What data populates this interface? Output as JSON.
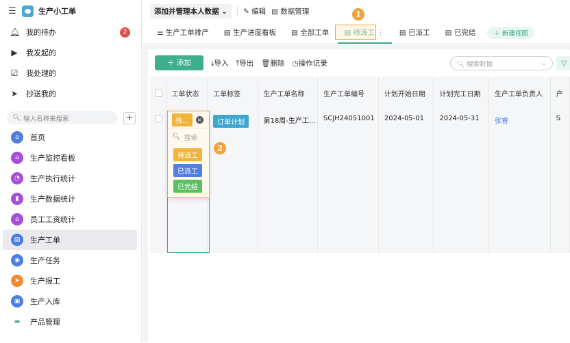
{
  "app": {
    "title": "生产小工单"
  },
  "sidebar": {
    "top_items": [
      {
        "label": "我的待办",
        "icon": "bell-icon",
        "badge": "2"
      },
      {
        "label": "我发起的",
        "icon": "play-icon"
      },
      {
        "label": "我处理的",
        "icon": "inbox-check-icon"
      },
      {
        "label": "抄送我的",
        "icon": "send-icon"
      }
    ],
    "search_placeholder": "输入名称来搜索",
    "items": [
      {
        "label": "首页",
        "icon": "home-icon",
        "color": "#4a7ee0"
      },
      {
        "label": "生产监控看板",
        "icon": "home-icon",
        "color": "#a64fd8"
      },
      {
        "label": "生产执行统计",
        "icon": "pie-icon",
        "color": "#a64fd8"
      },
      {
        "label": "生产数据统计",
        "icon": "bar-chart-icon",
        "color": "#a64fd8"
      },
      {
        "label": "员工工资统计",
        "icon": "house-icon",
        "color": "#a64fd8"
      },
      {
        "label": "生产工单",
        "icon": "document-icon",
        "color": "#4a7ee0",
        "active": true
      },
      {
        "label": "生产任务",
        "icon": "target-icon",
        "color": "#4a7ee0"
      },
      {
        "label": "生产报工",
        "icon": "send-icon",
        "color": "#ef8a2e"
      },
      {
        "label": "生产入库",
        "icon": "clipboard-icon",
        "color": "#4a7ee0"
      },
      {
        "label": "产品管理",
        "icon": "folder-icon",
        "color": "#3fae8c"
      }
    ]
  },
  "topbar": {
    "dropdown": "添加并管理本人数据",
    "edit": "编辑",
    "data_manage": "数据管理"
  },
  "tabs": [
    "生产工单排产",
    "生产进度看板",
    "全部工单",
    "待派工",
    "已派工",
    "已完结"
  ],
  "active_tab": "待派工",
  "new_view": "新建视图",
  "toolbar": {
    "add": "添加",
    "import": "导入",
    "export": "导出",
    "delete": "删除",
    "log": "操作记录",
    "search_placeholder": "搜索数据"
  },
  "table": {
    "headers": [
      "工单状态",
      "工单标签",
      "生产工单名称",
      "生产工单编号",
      "计划开始日期",
      "计划完工日期",
      "生产工单负责人",
      "产"
    ],
    "row": {
      "status": "待...",
      "tag": "订单计划",
      "name": "第18周-生产工...",
      "code": "SCJH24051001",
      "start": "2024-05-01",
      "end": "2024-05-31",
      "owner": "张睿",
      "next": "S"
    }
  },
  "status_popup": {
    "search_placeholder": "搜索",
    "options": [
      {
        "label": "待派工",
        "color": "#f0b43c"
      },
      {
        "label": "已派工",
        "color": "#4f7fe0"
      },
      {
        "label": "已完结",
        "color": "#5cbf62"
      }
    ]
  },
  "markers": [
    "1",
    "2"
  ],
  "colors": {
    "accent": "#3fae8c",
    "highlight": "#f2a23b",
    "tag": "#3fa6d0"
  }
}
